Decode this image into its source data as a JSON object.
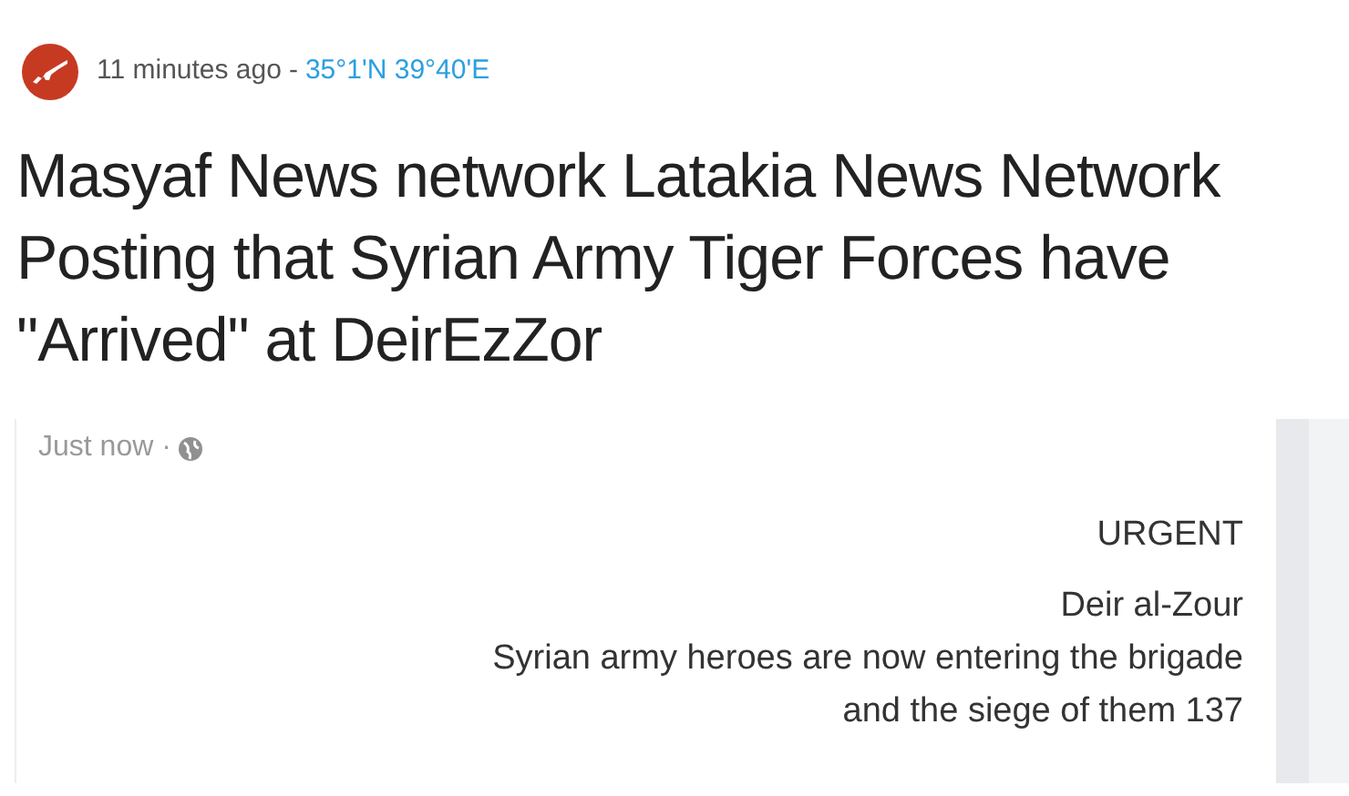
{
  "post": {
    "time": "11 minutes ago",
    "separator": "-",
    "location": "35°1'N 39°40'E"
  },
  "title": "Masyaf News network Latakia News Network Posting that Syrian Army Tiger Forces have \"Arrived\" at DeirEzZor",
  "embedded_post": {
    "time": "Just now ·",
    "lines": [
      {
        "text": "URGENT"
      },
      {
        "text": "Deir al-Zour"
      },
      {
        "text": "Syrian army heroes are now entering the brigade"
      },
      {
        "text": "and the siege of them 137"
      }
    ]
  }
}
